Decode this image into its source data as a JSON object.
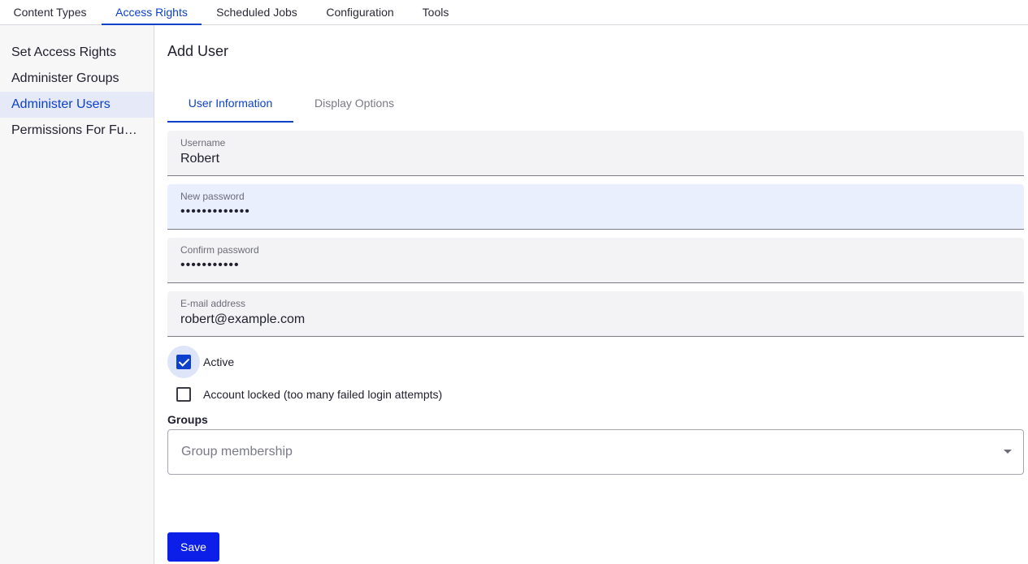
{
  "topnav": {
    "tabs": [
      {
        "label": "Content Types"
      },
      {
        "label": "Access Rights"
      },
      {
        "label": "Scheduled Jobs"
      },
      {
        "label": "Configuration"
      },
      {
        "label": "Tools"
      }
    ],
    "active_tab": "Access Rights"
  },
  "sidebar": {
    "items": [
      {
        "label": "Set Access Rights"
      },
      {
        "label": "Administer Groups"
      },
      {
        "label": "Administer Users"
      },
      {
        "label": "Permissions For Functions"
      }
    ],
    "active_item": "Administer Users"
  },
  "main": {
    "title": "Add User",
    "tabs": [
      {
        "label": "User Information"
      },
      {
        "label": "Display Options"
      }
    ],
    "active_tab": "User Information",
    "form": {
      "username": {
        "label": "Username",
        "value": "Robert"
      },
      "new_password": {
        "label": "New password",
        "value": "•••••••••••••"
      },
      "confirm_password": {
        "label": "Confirm password",
        "value": "•••••••••••"
      },
      "email": {
        "label": "E-mail address",
        "value": "robert@example.com"
      },
      "active": {
        "label": "Active",
        "checked": true
      },
      "locked": {
        "label": "Account locked (too many failed login attempts)",
        "checked": false
      },
      "groups": {
        "heading": "Groups",
        "placeholder": "Group membership"
      }
    },
    "save_label": "Save"
  },
  "colors": {
    "accent": "#0b41cd",
    "save_button": "#0b1fe8",
    "sidebar_active_bg": "#e6e9f7",
    "field_bg": "#f3f3f5",
    "field_focused_bg": "#e9effd"
  },
  "icons": {
    "select_caret": "chevron-down-icon",
    "checkbox_checked": "checkmark-icon"
  }
}
